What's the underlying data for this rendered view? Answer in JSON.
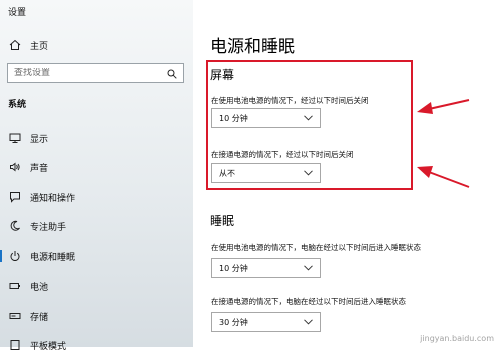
{
  "window": {
    "title": "设置"
  },
  "sidebar": {
    "home_label": "主页",
    "search_placeholder": "查找设置",
    "section_label": "系统",
    "items": [
      {
        "label": "显示",
        "icon": "monitor-icon"
      },
      {
        "label": "声音",
        "icon": "speaker-icon"
      },
      {
        "label": "通知和操作",
        "icon": "notification-icon"
      },
      {
        "label": "专注助手",
        "icon": "moon-icon"
      },
      {
        "label": "电源和睡眠",
        "icon": "power-icon",
        "active": true
      },
      {
        "label": "电池",
        "icon": "battery-icon"
      },
      {
        "label": "存储",
        "icon": "storage-icon"
      },
      {
        "label": "平板模式",
        "icon": "tablet-icon"
      }
    ]
  },
  "main": {
    "title": "电源和睡眠",
    "screen": {
      "heading": "屏幕",
      "battery_label": "在使用电池电源的情况下，经过以下时间后关闭",
      "battery_value": "10 分钟",
      "plugged_label": "在接通电源的情况下，经过以下时间后关闭",
      "plugged_value": "从不"
    },
    "sleep": {
      "heading": "睡眠",
      "battery_label": "在使用电池电源的情况下，电脑在经过以下时间后进入睡眠状态",
      "battery_value": "10 分钟",
      "plugged_label": "在接通电源的情况下，电脑在经过以下时间后进入睡眠状态",
      "plugged_value": "30 分钟"
    }
  },
  "annotation": {
    "highlight_color": "#d9192a"
  },
  "watermark": "jingyan.baidu.com"
}
